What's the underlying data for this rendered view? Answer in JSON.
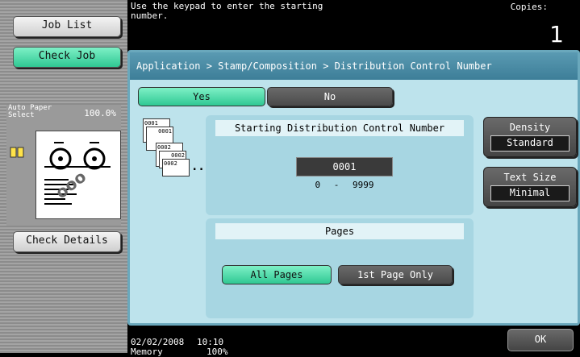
{
  "left": {
    "job_list": "Job List",
    "check_job": "Check Job",
    "paper_select": "Auto Paper\nSelect",
    "zoom": "100.0%",
    "stamp_preview": "ooo",
    "check_details": "Check Details"
  },
  "header": {
    "message": "Use the keypad to enter the starting\nnumber.",
    "copies_label": "Copies:",
    "copies_value": "1"
  },
  "breadcrumb": "Application > Stamp/Composition > Distribution Control Number",
  "toggle": {
    "yes": "Yes",
    "no": "No",
    "selected": "Yes"
  },
  "illustration": {
    "sheet1": "0001",
    "sheet2": "0001",
    "sheet3": "0002",
    "sheet4": "0002",
    "sheet5": "0002",
    "ellipsis": "..."
  },
  "start_number": {
    "title": "Starting Distribution Control Number",
    "value": "0001",
    "range_min": "0",
    "range_sep": "-",
    "range_max": "9999"
  },
  "pages": {
    "title": "Pages",
    "all_pages": "All Pages",
    "first_page": "1st Page Only",
    "selected": "All Pages"
  },
  "density": {
    "label": "Density",
    "value": "Standard"
  },
  "text_size": {
    "label": "Text Size",
    "value": "Minimal"
  },
  "footer": {
    "date": "02/02/2008",
    "time": "10:10",
    "memory_label": "Memory",
    "memory_value": "100%",
    "ok": "OK"
  },
  "colors": {
    "selected_green": "#2fc893",
    "panel_blue": "#bde3ec",
    "header_blue": "#3d7e98"
  }
}
